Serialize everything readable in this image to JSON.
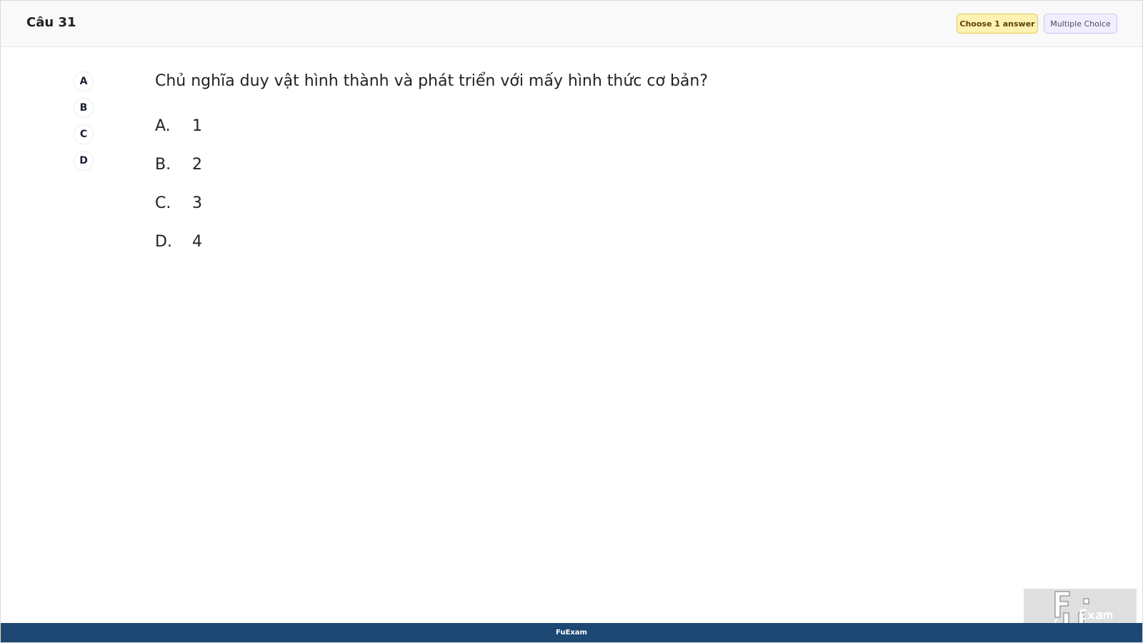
{
  "header": {
    "question_label": "Câu 31",
    "badge_answer": "Choose 1 answer",
    "badge_type": "Multiple Choice"
  },
  "side_options": [
    "A",
    "B",
    "C",
    "D"
  ],
  "question": {
    "text": "Chủ nghĩa duy vật hình thành và phát triển với mấy hình thức cơ bản?",
    "answers": [
      {
        "letter": "A.",
        "text": "1"
      },
      {
        "letter": "B.",
        "text": "2"
      },
      {
        "letter": "C.",
        "text": "3"
      },
      {
        "letter": "D.",
        "text": "4"
      }
    ]
  },
  "watermark": {
    "logo_text": "FUExam"
  },
  "footer": {
    "text": "FuExam"
  },
  "colors": {
    "footer_bg": "#1e4874",
    "badge_answer_bg": "#fdf1b3",
    "badge_type_bg": "#f1efff"
  }
}
